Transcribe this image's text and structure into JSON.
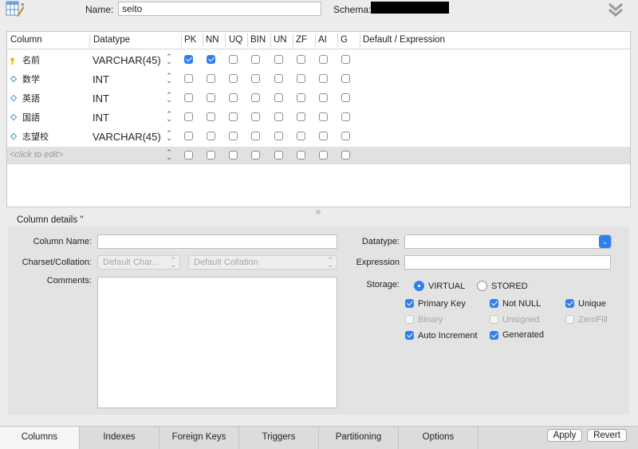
{
  "header": {
    "name_label": "Name:",
    "name_value": "seito",
    "schema_label": "Schema:",
    "table_icon": "table-edit-icon",
    "collapse_icon": "double-chevron-down-icon"
  },
  "grid": {
    "headers": [
      "Column",
      "Datatype",
      "PK",
      "NN",
      "UQ",
      "BIN",
      "UN",
      "ZF",
      "AI",
      "G",
      "Default / Expression"
    ],
    "rows": [
      {
        "name": "名前",
        "type": "VARCHAR(45)",
        "icon": "primary-key-icon",
        "flags": [
          true,
          true,
          false,
          false,
          false,
          false,
          false,
          false
        ]
      },
      {
        "name": "数学",
        "type": "INT",
        "icon": "column-diamond-icon",
        "flags": [
          false,
          false,
          false,
          false,
          false,
          false,
          false,
          false
        ]
      },
      {
        "name": "英語",
        "type": "INT",
        "icon": "column-diamond-icon",
        "flags": [
          false,
          false,
          false,
          false,
          false,
          false,
          false,
          false
        ]
      },
      {
        "name": "国語",
        "type": "INT",
        "icon": "column-diamond-icon",
        "flags": [
          false,
          false,
          false,
          false,
          false,
          false,
          false,
          false
        ]
      },
      {
        "name": "志望校",
        "type": "VARCHAR(45)",
        "icon": "column-diamond-icon",
        "flags": [
          false,
          false,
          false,
          false,
          false,
          false,
          false,
          false
        ]
      }
    ],
    "new_row_placeholder": "<click to edit>"
  },
  "details": {
    "title": "Column details ''",
    "column_name_label": "Column Name:",
    "charset_label": "Charset/Collation:",
    "charset_value": "Default Char...",
    "collation_value": "Default Collation",
    "comments_label": "Comments:",
    "datatype_label": "Datatype:",
    "expression_label": "Expression",
    "storage_label": "Storage:",
    "storage_virtual": "VIRTUAL",
    "storage_stored": "STORED",
    "storage_selected": "VIRTUAL",
    "options": [
      {
        "label": "Primary Key",
        "checked": true,
        "enabled": true
      },
      {
        "label": "Not NULL",
        "checked": true,
        "enabled": true
      },
      {
        "label": "Unique",
        "checked": true,
        "enabled": true
      },
      {
        "label": "Binary",
        "checked": false,
        "enabled": false
      },
      {
        "label": "Unsigned",
        "checked": false,
        "enabled": false
      },
      {
        "label": "ZeroFill",
        "checked": false,
        "enabled": false
      },
      {
        "label": "Auto Increment",
        "checked": true,
        "enabled": true
      },
      {
        "label": "Generated",
        "checked": true,
        "enabled": true
      }
    ]
  },
  "tabs": [
    "Columns",
    "Indexes",
    "Foreign Keys",
    "Triggers",
    "Partitioning",
    "Options"
  ],
  "active_tab": "Columns",
  "buttons": {
    "apply": "Apply",
    "revert": "Revert"
  },
  "colors": {
    "accent": "#2f7ff0",
    "key": "#e8b800",
    "column_icon": "#3a9bb0"
  }
}
